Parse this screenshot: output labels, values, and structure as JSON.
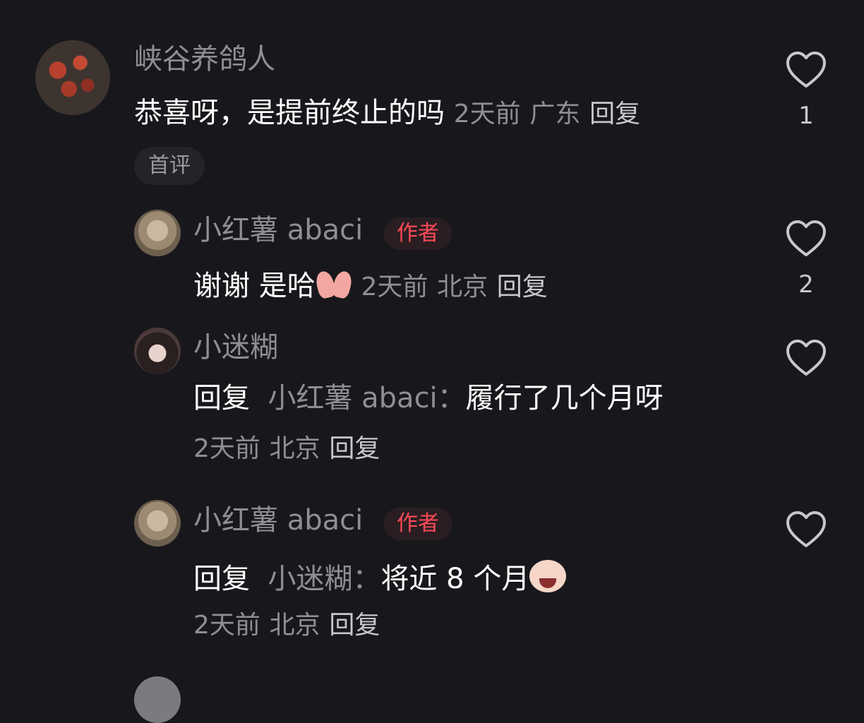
{
  "comments": [
    {
      "username": "峡谷养鸽人",
      "text": "恭喜呀，是提前终止的吗",
      "time": "2天前",
      "location": "广东",
      "reply_label": "回复",
      "badge": "首评",
      "like_count": "1"
    },
    {
      "username": "小红薯 abaci",
      "author_badge": "作者",
      "text": "谢谢 是哈",
      "emoji": "pray-hands-emoji",
      "time": "2天前",
      "location": "北京",
      "reply_label": "回复",
      "like_count": "2"
    },
    {
      "username": "小迷糊",
      "reply_prefix": "回复",
      "reply_target": "小红薯 abaci",
      "text": "履行了几个月呀",
      "time": "2天前",
      "location": "北京",
      "reply_label": "回复",
      "like_count": ""
    },
    {
      "username": "小红薯 abaci",
      "author_badge": "作者",
      "reply_prefix": "回复",
      "reply_target": "小迷糊",
      "text": "将近 8 个月",
      "emoji": "crying-laughing-emoji",
      "time": "2天前",
      "location": "北京",
      "reply_label": "回复",
      "like_count": ""
    }
  ],
  "colors": {
    "background": "#18181c",
    "author_badge": "#ff4a57",
    "muted": "#8e8e93"
  },
  "icons": {
    "like": "heart-outline-icon"
  }
}
